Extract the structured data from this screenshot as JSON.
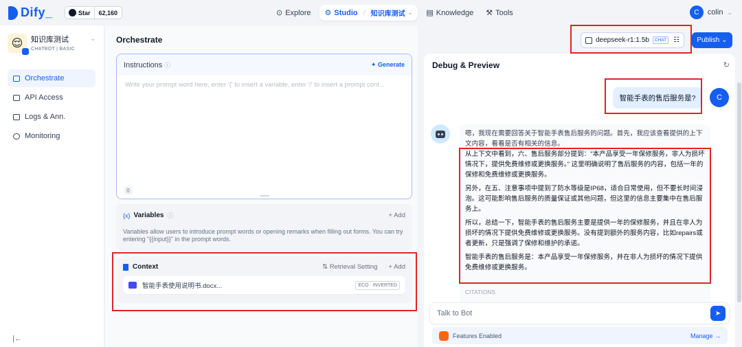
{
  "header": {
    "logo_text": "Dify",
    "github_star_label": "Star",
    "github_star_count": "62,160",
    "nav": {
      "explore": "Explore",
      "studio": "Studio",
      "app_name": "知识库测试",
      "knowledge": "Knowledge",
      "tools": "Tools"
    },
    "user_initial": "C",
    "user_name": "colin"
  },
  "sidebar": {
    "app_name": "知识库测试",
    "app_type": "CHATBOT",
    "app_mode": "BASIC",
    "items": [
      {
        "label": "Orchestrate",
        "active": true
      },
      {
        "label": "API Access",
        "active": false
      },
      {
        "label": "Logs & Ann.",
        "active": false
      },
      {
        "label": "Monitoring",
        "active": false
      }
    ]
  },
  "orchestrate": {
    "title": "Orchestrate",
    "instructions_label": "Instructions",
    "generate_label": "Generate",
    "instructions_placeholder": "Write your prompt word here, enter '{' to insert a variable, enter '/' to insert a prompt cont...",
    "char_count": "0",
    "variables": {
      "title": "Variables",
      "add_label": "+ Add",
      "description": "Variables allow users to introduce prompt words or opening remarks when filling out forms. You can try entering \"{{input}}\" in the prompt words."
    },
    "context": {
      "title": "Context",
      "retrieval_setting": "Retrieval Setting",
      "add_label": "+ Add",
      "file_name": "智能手表使用说明书.docx...",
      "file_tag": "ECO · INVERTED"
    }
  },
  "model_selector": {
    "model_name": "deepseek-r1:1.5b",
    "mode_tag": "CHAT"
  },
  "publish_label": "Publish",
  "debug": {
    "title": "Debug & Preview",
    "user_initial": "C",
    "user_message": "智能手表的售后服务是?",
    "bot_lead": "嗯，我现在需要回答关于智能手表售后服务的问题。首先，我应该查看提供的上下文内容，看看是否有相关的信息。",
    "bot_paragraphs": [
      "从上下文中看到，六、售后服务部分提到：“本产品享受一年保修服务，非人为损坏情况下，提供免费维修或更换服务。” 这里明确说明了售后服务的内容，包括一年的保修和免费维修或更换服务。",
      "另外，在五、注意事项中提到了防水等级是IP68，适合日常使用，但不要长时间浸泡。这可能影响售后服务的质量保证或其他问题，但这里的信息主要集中在售后服务上。",
      "所以，总结一下，智能手表的售后服务主要是提供一年的保修服务，并且在非人为损坏的情况下提供免费维修或更换服务。没有提到额外的服务内容，比如repairs或者更新，只是强调了保修和维护的承诺。",
      "智能手表的售后服务是：本产品享受一年保修服务，并在非人为损坏的情况下提供免费维修或更换服务。"
    ],
    "citations_label": "CITATIONS",
    "input_placeholder": "Talk to Bot",
    "features_label": "Features Enabled",
    "manage_label": "Manage →"
  },
  "colors": {
    "primary": "#155eef",
    "highlight": "#e02424"
  }
}
